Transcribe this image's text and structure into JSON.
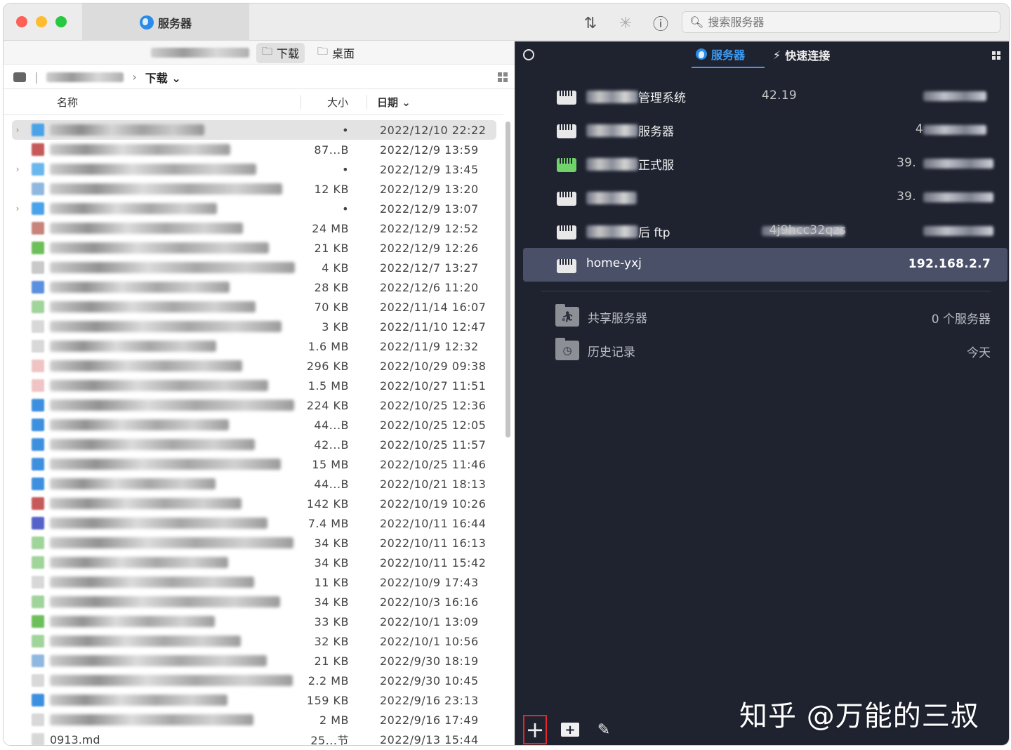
{
  "titlebar": {
    "tab_title": "服务器",
    "search_placeholder": "搜索服务器",
    "icons": [
      "sort-icon",
      "spinner-icon",
      "info-icon",
      "search-icon"
    ]
  },
  "left": {
    "shortcuts": [
      {
        "label": "下载",
        "active": true
      },
      {
        "label": "桌面",
        "active": false
      }
    ],
    "path_current": "下载",
    "columns": {
      "name": "名称",
      "size": "大小",
      "date": "日期"
    },
    "files": [
      {
        "size": "•",
        "date": "2022/12/10 22:22",
        "folder": true,
        "selected": true,
        "color": "#4aa3e8"
      },
      {
        "size": "87...B",
        "date": "2022/12/9 13:59",
        "color": "#c65a5a"
      },
      {
        "size": "•",
        "date": "2022/12/9 13:45",
        "folder": true,
        "color": "#6ab6ef"
      },
      {
        "size": "12 KB",
        "date": "2022/12/9 13:20",
        "color": "#8fb7e0"
      },
      {
        "size": "•",
        "date": "2022/12/9 13:07",
        "folder": true,
        "color": "#4aa3e8"
      },
      {
        "size": "24 MB",
        "date": "2022/12/9 12:52",
        "color": "#c8837a"
      },
      {
        "size": "21 KB",
        "date": "2022/12/9 12:26",
        "color": "#6cbf5a"
      },
      {
        "size": "4 KB",
        "date": "2022/12/7 13:27",
        "color": "#c9c9c9"
      },
      {
        "size": "28 KB",
        "date": "2022/12/6 11:20",
        "color": "#5b8fe0"
      },
      {
        "size": "70 KB",
        "date": "2022/11/14 16:07",
        "color": "#9fd49a"
      },
      {
        "size": "3 KB",
        "date": "2022/11/10 12:47",
        "color": "#d8d8d8"
      },
      {
        "size": "1.6 MB",
        "date": "2022/11/9 12:32",
        "color": "#d8d8d8"
      },
      {
        "size": "296 KB",
        "date": "2022/10/29 09:38",
        "color": "#f0c4c4"
      },
      {
        "size": "1.5 MB",
        "date": "2022/10/27 11:51",
        "color": "#f0c4c4"
      },
      {
        "size": "224 KB",
        "date": "2022/10/25 12:36",
        "color": "#3d8fe0"
      },
      {
        "size": "44...B",
        "date": "2022/10/25 12:05",
        "color": "#3d8fe0"
      },
      {
        "size": "42...B",
        "date": "2022/10/25 11:57",
        "color": "#3d8fe0"
      },
      {
        "size": "15 MB",
        "date": "2022/10/25 11:46",
        "color": "#3d8fe0"
      },
      {
        "size": "44...B",
        "date": "2022/10/21 18:13",
        "color": "#3d8fe0"
      },
      {
        "size": "142 KB",
        "date": "2022/10/19 10:26",
        "color": "#c65a5a"
      },
      {
        "size": "7.4 MB",
        "date": "2022/10/11 16:44",
        "color": "#5562c8"
      },
      {
        "size": "34 KB",
        "date": "2022/10/11 16:13",
        "color": "#9fd49a"
      },
      {
        "size": "34 KB",
        "date": "2022/10/11 15:42",
        "color": "#9fd49a"
      },
      {
        "size": "11 KB",
        "date": "2022/10/9 17:43",
        "color": "#d8d8d8"
      },
      {
        "size": "34 KB",
        "date": "2022/10/3 16:16",
        "color": "#9fd49a"
      },
      {
        "size": "33 KB",
        "date": "2022/10/1 13:09",
        "color": "#6cbf5a"
      },
      {
        "size": "32 KB",
        "date": "2022/10/1 10:56",
        "color": "#9fd49a"
      },
      {
        "size": "21 KB",
        "date": "2022/9/30 18:19",
        "color": "#8fb7e0"
      },
      {
        "size": "2.2 MB",
        "date": "2022/9/30 10:45",
        "color": "#d8d8d8"
      },
      {
        "size": "159 KB",
        "date": "2022/9/16 23:13",
        "color": "#3d8fe0"
      },
      {
        "size": "2 MB",
        "date": "2022/9/16 17:49",
        "color": "#d8d8d8"
      },
      {
        "size": "25...节",
        "date": "2022/9/13 15:44",
        "name": "0913.md",
        "color": "#d8d8d8"
      }
    ]
  },
  "right": {
    "tabs": [
      {
        "label": "服务器",
        "active": true
      },
      {
        "label": "快速连接",
        "active": false
      }
    ],
    "servers": [
      {
        "name": "管理系统",
        "address": "42.19",
        "green": false
      },
      {
        "name": "服务器",
        "address": "4",
        "green": false
      },
      {
        "name": "正式服",
        "address": "39.",
        "green": true
      },
      {
        "name": "",
        "address": "39.",
        "green": false
      },
      {
        "name": "后 ftp",
        "address": "4j9hcc32qzs",
        "green": false
      },
      {
        "name": "home-yxj",
        "address": "192.168.2.7",
        "green": false,
        "selected": true
      }
    ],
    "groups": [
      {
        "label": "共享服务器",
        "value": "0 个服务器"
      },
      {
        "label": "历史记录",
        "value": "今天"
      }
    ],
    "watermark": "知乎 @万能的三叔"
  }
}
